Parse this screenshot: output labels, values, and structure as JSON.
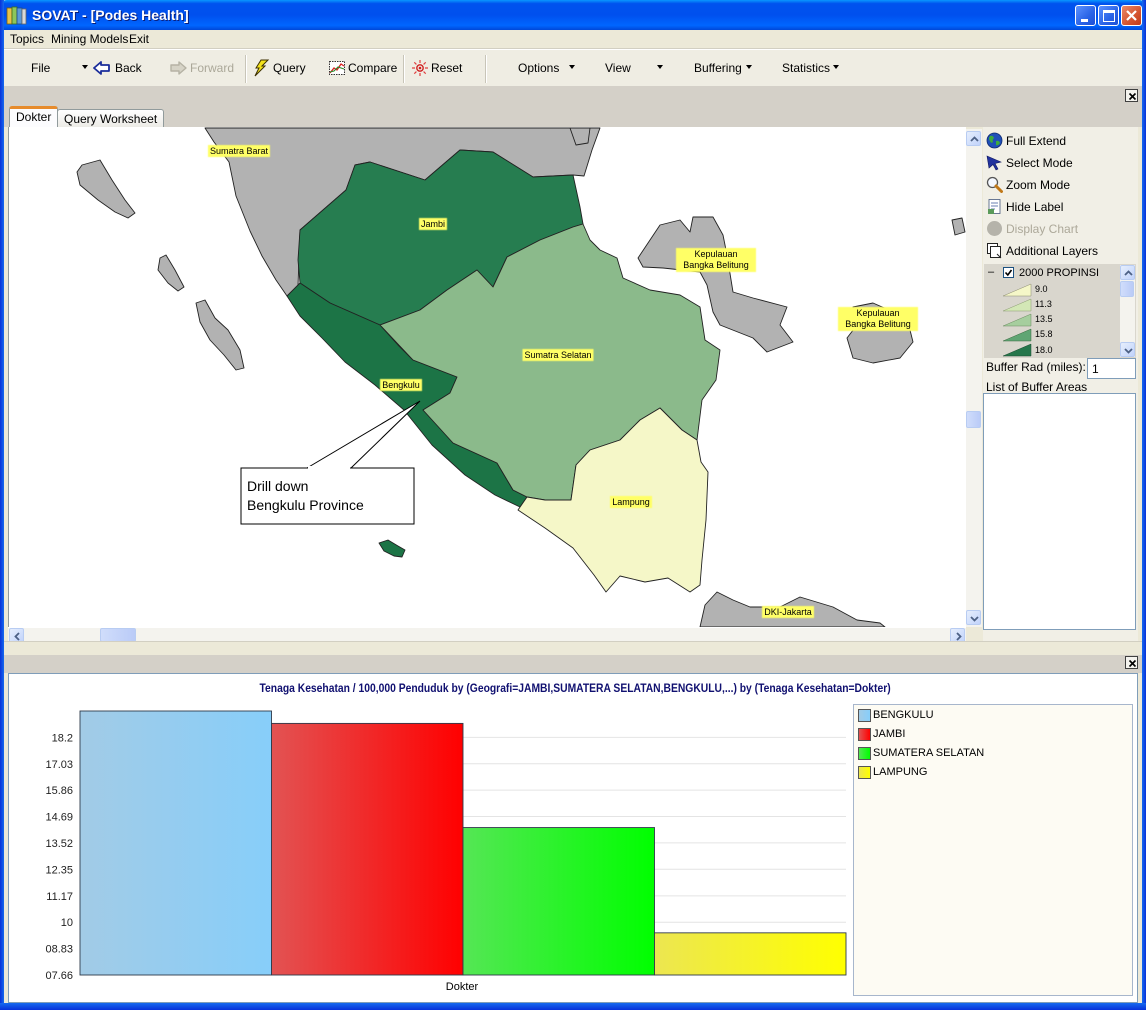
{
  "window": {
    "title": "SOVAT - [Podes Health]"
  },
  "menu": [
    {
      "label": "Topics"
    },
    {
      "label": "Mining Models"
    },
    {
      "label": "Exit"
    }
  ],
  "toolbar": {
    "file": "File",
    "back": "Back",
    "forward": "Forward",
    "query": "Query",
    "compare": "Compare",
    "reset": "Reset",
    "options": "Options",
    "view": "View",
    "buffering": "Buffering",
    "statistics": "Statistics"
  },
  "tabs": [
    {
      "label": "Dokter",
      "active": true
    },
    {
      "label": "Query Worksheet",
      "active": false
    }
  ],
  "map": {
    "colors": {
      "other": "#B2B2B2",
      "jambi": "#267D50",
      "bengkulu": "#1C7446",
      "sumatra_selatan": "#8BBA8B",
      "lampung": "#F5F7C8"
    },
    "labels": {
      "sumatra_barat": "Sumatra Barat",
      "jambi": "Jambi",
      "bangka_belitung_1": "Kepulauan Bangka Belitung",
      "bangka_belitung_2": "Kepulauan Bangka Belitung",
      "sumatra_selatan": "Sumatra Selatan",
      "bengkulu": "Bengkulu",
      "lampung": "Lampung",
      "dki_jakarta": "DKI-Jakarta"
    },
    "callout": {
      "line1": "Drill down",
      "line2": "Bengkulu Province"
    }
  },
  "map_tools": [
    {
      "label": "Full Extend",
      "icon": "globe-icon",
      "enabled": true
    },
    {
      "label": "Select Mode",
      "icon": "pointer-icon",
      "enabled": true
    },
    {
      "label": "Zoom Mode",
      "icon": "magnifier-icon",
      "enabled": true
    },
    {
      "label": "Hide Label",
      "icon": "label-icon",
      "enabled": true
    },
    {
      "label": "Display Chart",
      "icon": "chart-circle-icon",
      "enabled": false
    },
    {
      "label": "Additional Layers",
      "icon": "layers-icon",
      "enabled": true
    }
  ],
  "layer_legend": {
    "collapse_symbol": "–",
    "layer_name": "2000 PROPINSI",
    "checked": true,
    "classes": [
      {
        "value": "9.0",
        "color": "#F5F7C8"
      },
      {
        "value": "11.3",
        "color": "#D3E7B6"
      },
      {
        "value": "13.5",
        "color": "#A6CE9E"
      },
      {
        "value": "15.8",
        "color": "#5FA573"
      },
      {
        "value": "18.0",
        "color": "#26774B"
      }
    ]
  },
  "buffer": {
    "radius_label": "Buffer Rad (miles):",
    "radius_value": "1",
    "list_label": "List of Buffer Areas"
  },
  "chart_data": {
    "type": "bar",
    "title": "Tenaga Kesehatan / 100,000 Penduduk by (Geografi=JAMBI,SUMATERA SELATAN,BENGKULU,...) by (Tenaga Kesehatan=Dokter)",
    "xlabel": "",
    "ylabel": "",
    "categories": [
      "Dokter"
    ],
    "series": [
      {
        "name": "BENGKULU",
        "values": [
          19.37
        ],
        "color": "#87CEFA",
        "color_light": "#A2CBE6"
      },
      {
        "name": "JAMBI",
        "values": [
          18.82
        ],
        "color": "#FF0000",
        "color_light": "#E25353"
      },
      {
        "name": "SUMATERA SELATAN",
        "values": [
          14.2
        ],
        "color": "#00FF00",
        "color_light": "#55E655"
      },
      {
        "name": "LAMPUNG",
        "values": [
          9.53
        ],
        "color": "#FFFF00",
        "color_light": "#ECE651"
      }
    ],
    "ylim": [
      7.66,
      19.37
    ],
    "yticks": [
      18.2,
      17.03,
      15.86,
      14.69,
      13.52,
      12.35,
      11.17,
      10,
      8.83,
      7.66
    ],
    "ytick_labels": [
      "18.2",
      "17.03",
      "15.86",
      "14.69",
      "13.52",
      "12.35",
      "11.17",
      "10",
      "08.83",
      "07.66"
    ],
    "grid": true,
    "legend": "right"
  }
}
